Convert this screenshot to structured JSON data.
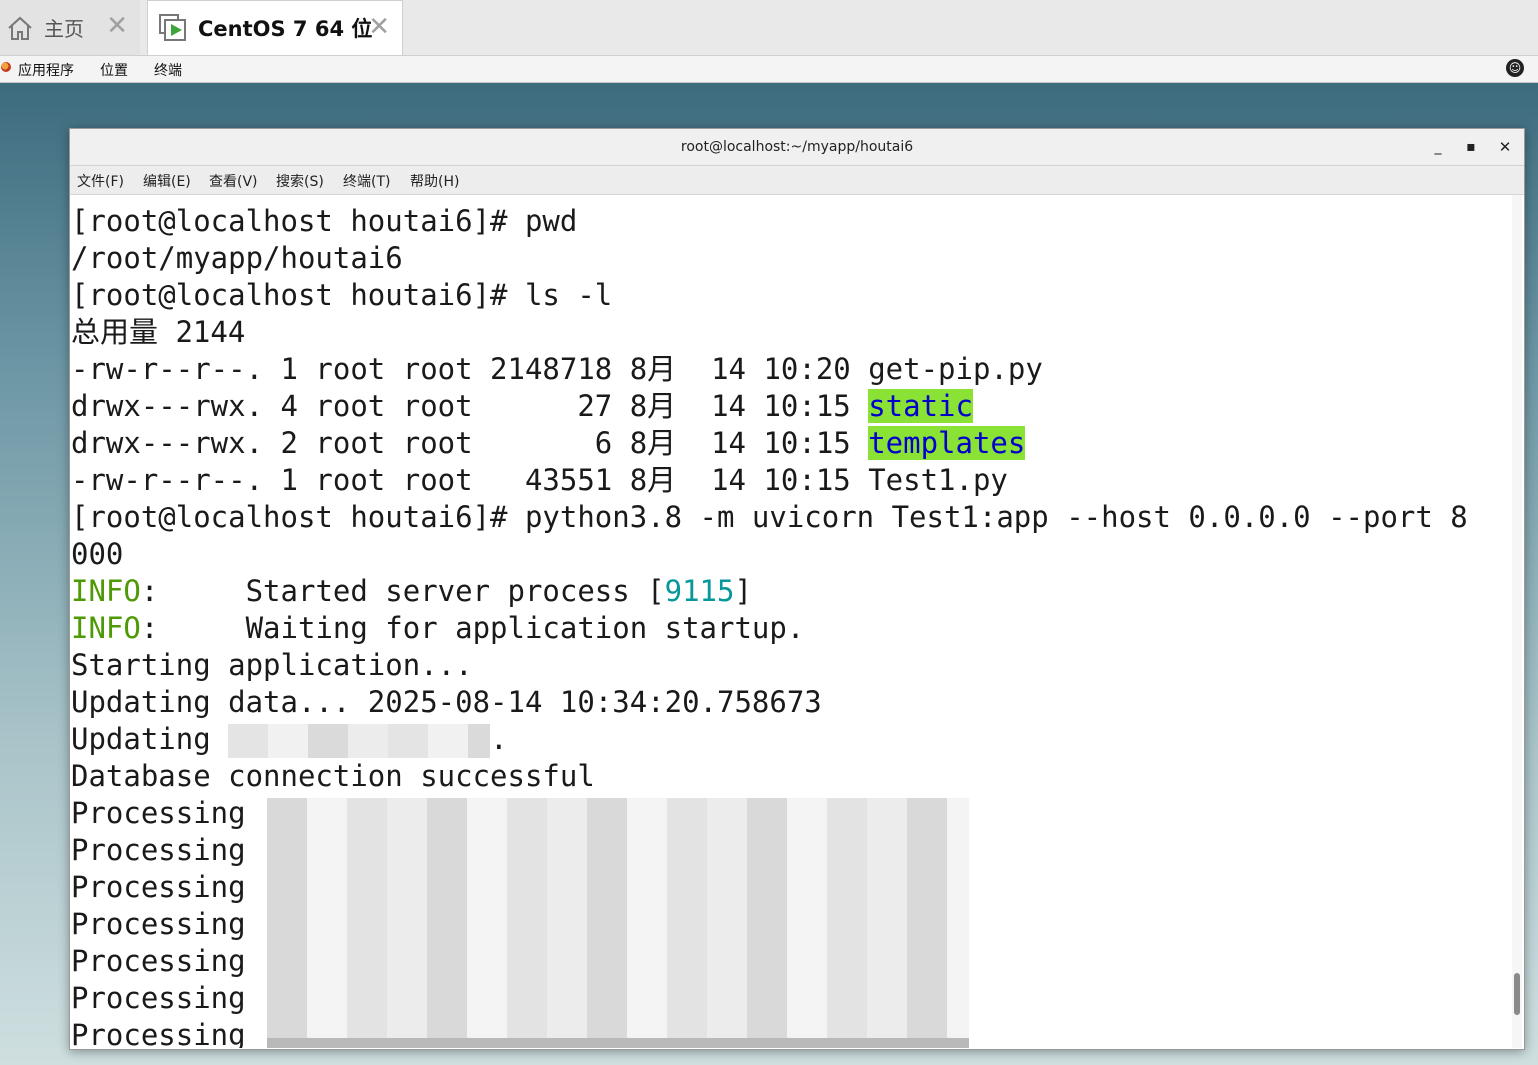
{
  "vm_tabs": {
    "home_label": "主页",
    "active_label": "CentOS 7 64 位",
    "close_glyph": "✕"
  },
  "gnome_menu": {
    "apps": "应用程序",
    "places": "位置",
    "terminal": "终端"
  },
  "window": {
    "title": "root@localhost:~/myapp/houtai6",
    "minimize": "_",
    "maximize": "▪",
    "close": "✕"
  },
  "menu_bar": {
    "file": "文件(F)",
    "edit": "编辑(E)",
    "view": "查看(V)",
    "search": "搜索(S)",
    "terminal": "终端(T)",
    "help": "帮助(H)"
  },
  "terminal": {
    "line1": "[root@localhost houtai6]# pwd",
    "line2": "/root/myapp/houtai6",
    "line3": "[root@localhost houtai6]# ls -l",
    "line4": "总用量 2144",
    "line5": "-rw-r--r--. 1 root root 2148718 8月  14 10:20 get-pip.py",
    "line6_prefix": "drwx---rwx. 4 root root      27 8月  14 10:15 ",
    "line6_name": "static",
    "line7_prefix": "drwx---rwx. 2 root root       6 8月  14 10:15 ",
    "line7_name": "templates",
    "line8": "-rw-r--r--. 1 root root   43551 8月  14 10:15 Test1.py",
    "line9": "[root@localhost houtai6]# python3.8 -m uvicorn Test1:app --host 0.0.0.0 --port 8",
    "line10": "000",
    "info_tag": "INFO",
    "line11_mid": ":     Started server process [",
    "line11_pid": "9115",
    "line11_end": "]",
    "line12_rest": ":     Waiting for application startup.",
    "line13": "Starting application...",
    "line14": "Updating data... 2025-08-14 10:34:20.758673",
    "line15_prefix": "Updating ",
    "line15_suffix": ".",
    "line16": "Database connection successful",
    "processing": "Processing"
  },
  "colors": {
    "info_green": "#4e9a06",
    "pid_cyan": "#06989a",
    "dir_highlight_bg": "#8ae234",
    "dir_highlight_fg": "#0000cc"
  },
  "icons": [
    "home-icon",
    "vm-icon",
    "apps-icon",
    "accessibility-icon"
  ]
}
